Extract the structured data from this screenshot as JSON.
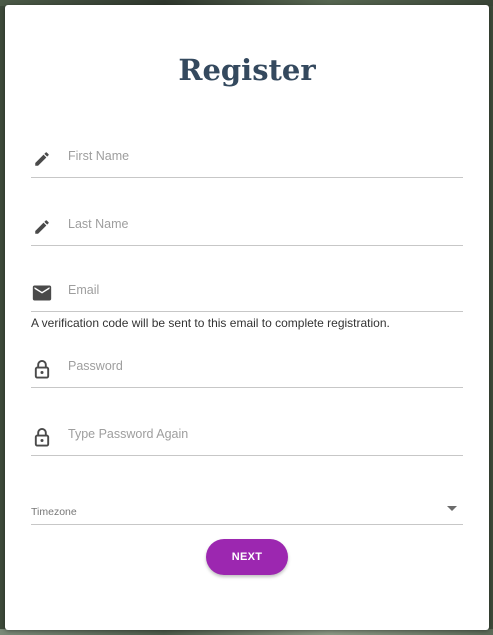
{
  "form": {
    "title": "Register",
    "fields": {
      "first_name": {
        "placeholder": "First Name",
        "value": "",
        "icon": "pencil-icon"
      },
      "last_name": {
        "placeholder": "Last Name",
        "value": "",
        "icon": "pencil-icon"
      },
      "email": {
        "placeholder": "Email",
        "value": "",
        "icon": "mail-icon"
      },
      "password": {
        "placeholder": "Password",
        "value": "",
        "icon": "lock-icon"
      },
      "password_again": {
        "placeholder": "Type Password Again",
        "value": "",
        "icon": "lock-icon"
      }
    },
    "email_helper": "A verification code will be sent to this email to complete registration.",
    "timezone": {
      "label": "Timezone",
      "value": ""
    },
    "next_label": "NEXT"
  },
  "colors": {
    "title": "#34495e",
    "icon": "#4a4a4a",
    "button": "#9c27b0",
    "button_text": "#ffffff",
    "underline": "#c7c7c7"
  }
}
